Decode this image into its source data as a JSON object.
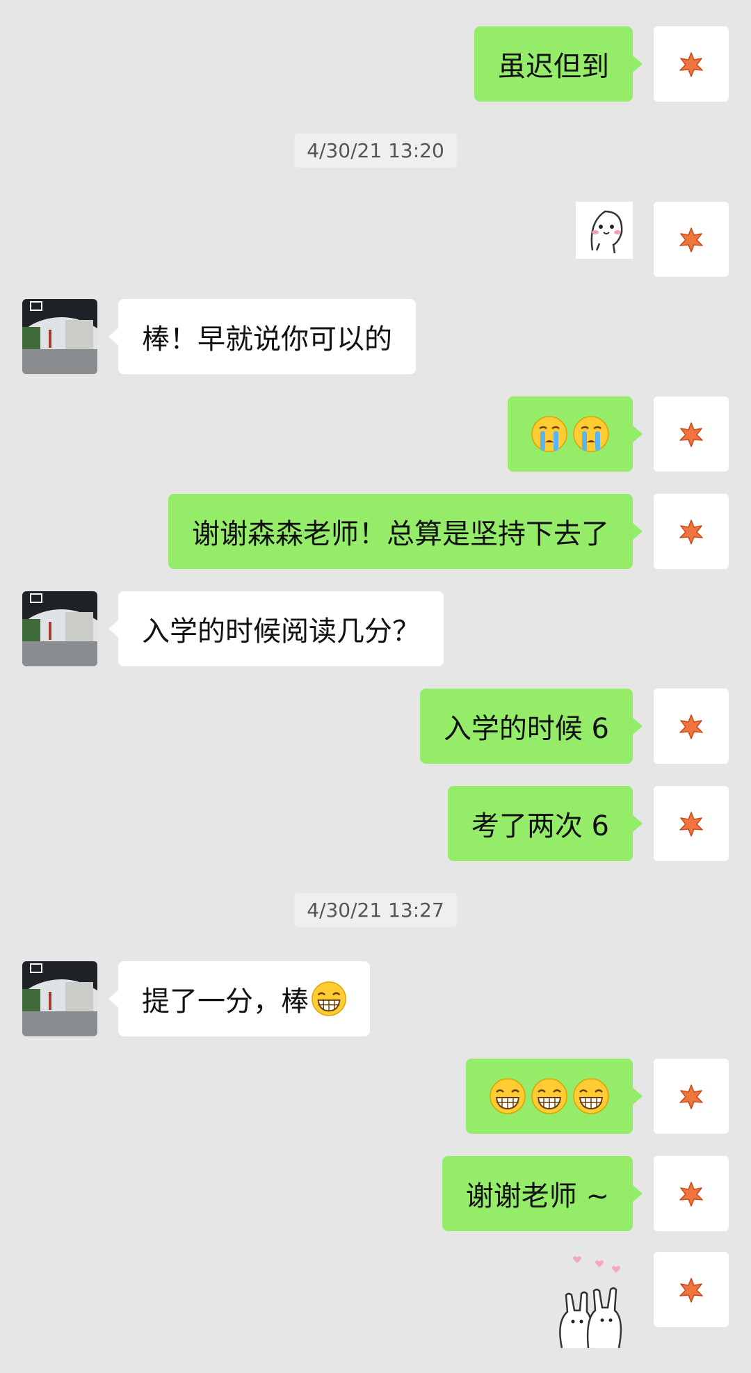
{
  "timestamps": [
    "4/30/21 13:20",
    "4/30/21 13:27"
  ],
  "messages": {
    "m1": "虽迟但到",
    "m3": "棒！早就说你可以的",
    "m5": "谢谢森森老师！总算是坚持下去了",
    "m6": "入学的时候阅读几分？",
    "m7": "入学的时候 6",
    "m8": "考了两次 6",
    "m9": "提了一分，棒",
    "m11": "谢谢老师 ~"
  },
  "icons": {
    "my_avatar": "maple-leaf-icon",
    "their_avatar": "basketball-court-photo",
    "sticker_1": "cute-ghost-sticker",
    "sticker_2": "bunnies-with-hearts-sticker",
    "crying_emoji": "crying-face-emoji",
    "grin_emoji": "grinning-face-emoji"
  },
  "colors": {
    "background": "#e6e6e6",
    "my_bubble": "#95ec69",
    "their_bubble": "#ffffff"
  }
}
